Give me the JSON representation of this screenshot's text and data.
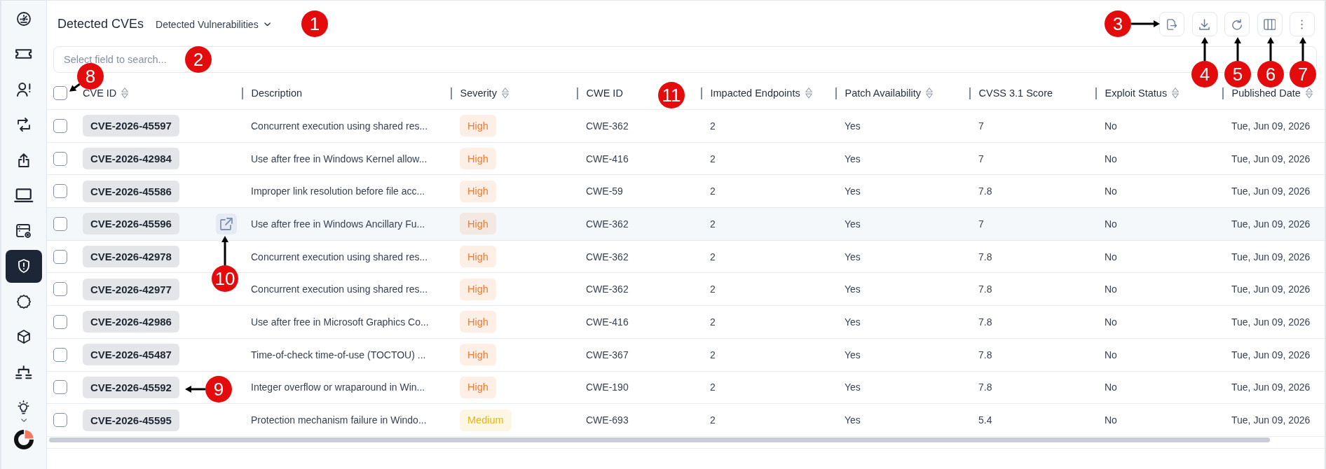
{
  "sidebar": {
    "items": [
      {
        "selected": false
      },
      {
        "selected": false
      },
      {
        "selected": false
      },
      {
        "selected": false
      },
      {
        "selected": false
      },
      {
        "selected": false
      },
      {
        "selected": false
      },
      {
        "selected": true
      },
      {
        "selected": false
      },
      {
        "selected": false
      },
      {
        "selected": false
      },
      {
        "selected": false
      }
    ]
  },
  "header": {
    "title": "Detected CVEs",
    "view_selector": {
      "label": "Detected Vulnerabilities"
    }
  },
  "search": {
    "placeholder": "Select field to search..."
  },
  "table": {
    "select_all": {
      "checked": false
    },
    "columns": [
      {
        "label": "CVE ID",
        "sortable": true
      },
      {
        "label": "Description",
        "sortable": false
      },
      {
        "label": "Severity",
        "sortable": true
      },
      {
        "label": "CWE ID",
        "sortable": false
      },
      {
        "label": "Impacted Endpoints",
        "sortable": true
      },
      {
        "label": "Patch Availability",
        "sortable": true
      },
      {
        "label": "CVSS 3.1 Score",
        "sortable": false
      },
      {
        "label": "Exploit Status",
        "sortable": true
      },
      {
        "label": "Published Date",
        "sortable": true
      }
    ],
    "rows": [
      {
        "checked": false,
        "hovered": false,
        "cve_id": "CVE-2026-45597",
        "description": "Concurrent execution using shared res...",
        "severity": {
          "label": "High",
          "color": "#f17c2f"
        },
        "cwe_id": "CWE-362",
        "impacted_endpoints": "2",
        "patch_availability": "Yes",
        "cvss_score": "7",
        "exploit_status": "No",
        "published_date": "Tue, Jun 09, 2026"
      },
      {
        "checked": false,
        "hovered": false,
        "cve_id": "CVE-2026-42984",
        "description": "Use after free in Windows Kernel allow...",
        "severity": {
          "label": "High",
          "color": "#f17c2f"
        },
        "cwe_id": "CWE-416",
        "impacted_endpoints": "2",
        "patch_availability": "Yes",
        "cvss_score": "7",
        "exploit_status": "No",
        "published_date": "Tue, Jun 09, 2026"
      },
      {
        "checked": false,
        "hovered": false,
        "cve_id": "CVE-2026-45586",
        "description": "Improper link resolution before file acc...",
        "severity": {
          "label": "High",
          "color": "#f17c2f"
        },
        "cwe_id": "CWE-59",
        "impacted_endpoints": "2",
        "patch_availability": "Yes",
        "cvss_score": "7.8",
        "exploit_status": "No",
        "published_date": "Tue, Jun 09, 2026"
      },
      {
        "checked": false,
        "hovered": true,
        "cve_id": "CVE-2026-45596",
        "description": "Use after free in Windows Ancillary Fu...",
        "severity": {
          "label": "High",
          "color": "#f17c2f"
        },
        "cwe_id": "CWE-362",
        "impacted_endpoints": "2",
        "patch_availability": "Yes",
        "cvss_score": "7",
        "exploit_status": "No",
        "published_date": "Tue, Jun 09, 2026"
      },
      {
        "checked": false,
        "hovered": false,
        "cve_id": "CVE-2026-42978",
        "description": "Concurrent execution using shared res...",
        "severity": {
          "label": "High",
          "color": "#f17c2f"
        },
        "cwe_id": "CWE-362",
        "impacted_endpoints": "2",
        "patch_availability": "Yes",
        "cvss_score": "7.8",
        "exploit_status": "No",
        "published_date": "Tue, Jun 09, 2026"
      },
      {
        "checked": false,
        "hovered": false,
        "cve_id": "CVE-2026-42977",
        "description": "Concurrent execution using shared res...",
        "severity": {
          "label": "High",
          "color": "#f17c2f"
        },
        "cwe_id": "CWE-362",
        "impacted_endpoints": "2",
        "patch_availability": "Yes",
        "cvss_score": "7.8",
        "exploit_status": "No",
        "published_date": "Tue, Jun 09, 2026"
      },
      {
        "checked": false,
        "hovered": false,
        "cve_id": "CVE-2026-42986",
        "description": "Use after free in Microsoft Graphics Co...",
        "severity": {
          "label": "High",
          "color": "#f17c2f"
        },
        "cwe_id": "CWE-416",
        "impacted_endpoints": "2",
        "patch_availability": "Yes",
        "cvss_score": "7.8",
        "exploit_status": "No",
        "published_date": "Tue, Jun 09, 2026"
      },
      {
        "checked": false,
        "hovered": false,
        "cve_id": "CVE-2026-45487",
        "description": "Time-of-check time-of-use (TOCTOU) ...",
        "severity": {
          "label": "High",
          "color": "#f17c2f"
        },
        "cwe_id": "CWE-367",
        "impacted_endpoints": "2",
        "patch_availability": "Yes",
        "cvss_score": "7.8",
        "exploit_status": "No",
        "published_date": "Tue, Jun 09, 2026"
      },
      {
        "checked": false,
        "hovered": false,
        "cve_id": "CVE-2026-45592",
        "description": "Integer overflow or wraparound in Win...",
        "severity": {
          "label": "High",
          "color": "#f17c2f"
        },
        "cwe_id": "CWE-190",
        "impacted_endpoints": "2",
        "patch_availability": "Yes",
        "cvss_score": "7.8",
        "exploit_status": "No",
        "published_date": "Tue, Jun 09, 2026"
      },
      {
        "checked": false,
        "hovered": false,
        "cve_id": "CVE-2026-45595",
        "description": "Protection mechanism failure in Windo...",
        "severity": {
          "label": "Medium",
          "color": "#e6b416"
        },
        "cwe_id": "CWE-693",
        "impacted_endpoints": "2",
        "patch_availability": "Yes",
        "cvss_score": "5.4",
        "exploit_status": "No",
        "published_date": "Tue, Jun 09, 2026"
      }
    ]
  },
  "callouts": [
    {
      "label": "1",
      "kind": "plain"
    },
    {
      "label": "3",
      "kind": "right"
    },
    {
      "label": "2",
      "kind": "plain"
    },
    {
      "label": "8",
      "kind": "diagonal"
    },
    {
      "label": "4",
      "kind": "up"
    },
    {
      "label": "5",
      "kind": "up"
    },
    {
      "label": "6",
      "kind": "up"
    },
    {
      "label": "7",
      "kind": "up"
    },
    {
      "label": "11",
      "kind": "plain"
    },
    {
      "label": "10",
      "kind": "up"
    },
    {
      "label": "9",
      "kind": "left"
    }
  ]
}
